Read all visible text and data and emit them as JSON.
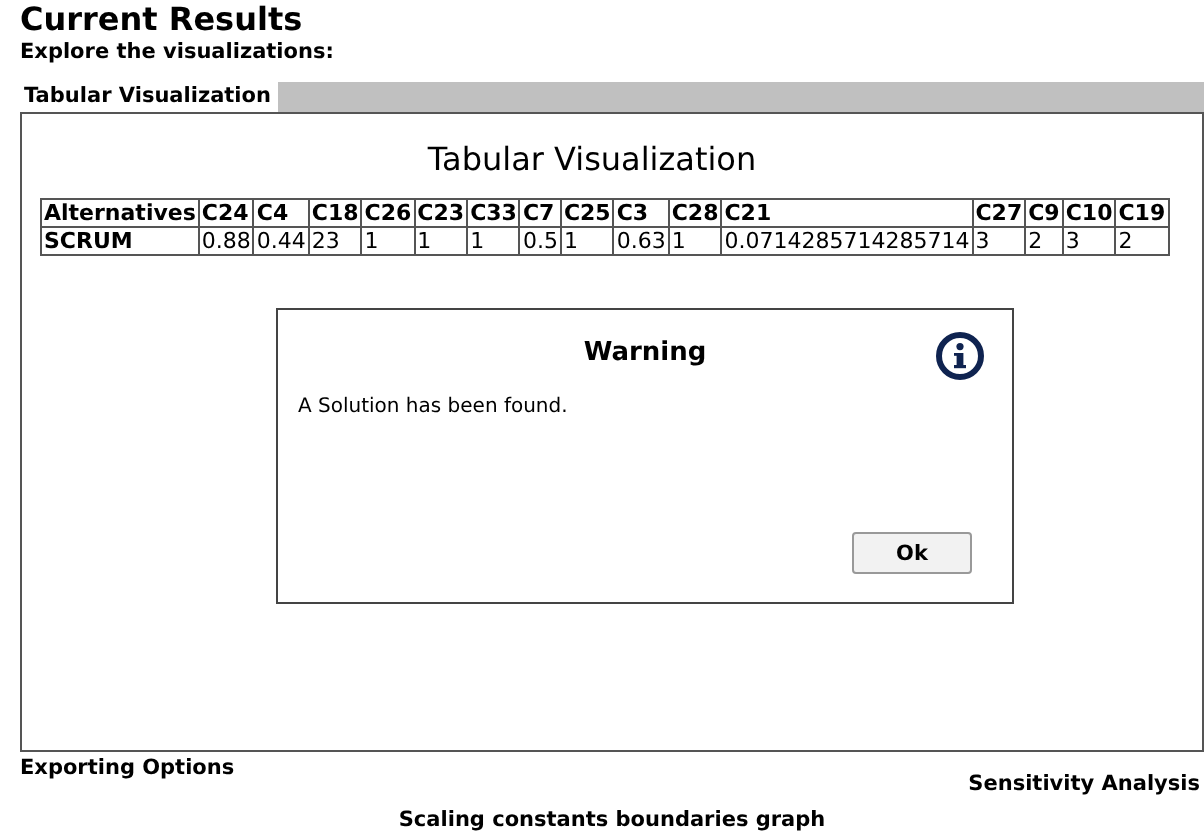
{
  "title": "Current Results",
  "subtitle": "Explore the visualizations:",
  "tabs": [
    {
      "label": "Tabular Visualization",
      "selected": true
    }
  ],
  "panel": {
    "heading": "Tabular Visualization",
    "table": {
      "columns": [
        "Alternatives",
        "C24",
        "C4",
        "C18",
        "C26",
        "C23",
        "C33",
        "C7",
        "C25",
        "C3",
        "C28",
        "C21",
        "C27",
        "C9",
        "C10",
        "C19"
      ],
      "rows": [
        [
          "SCRUM",
          "0.88",
          "0.44",
          "23",
          "1",
          "1",
          "1",
          "0.5",
          "1",
          "0.63",
          "1",
          "0.0714285714285714",
          "3",
          "2",
          "3",
          "2"
        ]
      ]
    }
  },
  "dialog": {
    "title": "Warning",
    "message": "A Solution has been found.",
    "button": "Ok"
  },
  "links": {
    "exporting": "Exporting Options",
    "sensitivity": "Sensitivity Analysis",
    "scaling": "Scaling constants boundaries graph"
  }
}
